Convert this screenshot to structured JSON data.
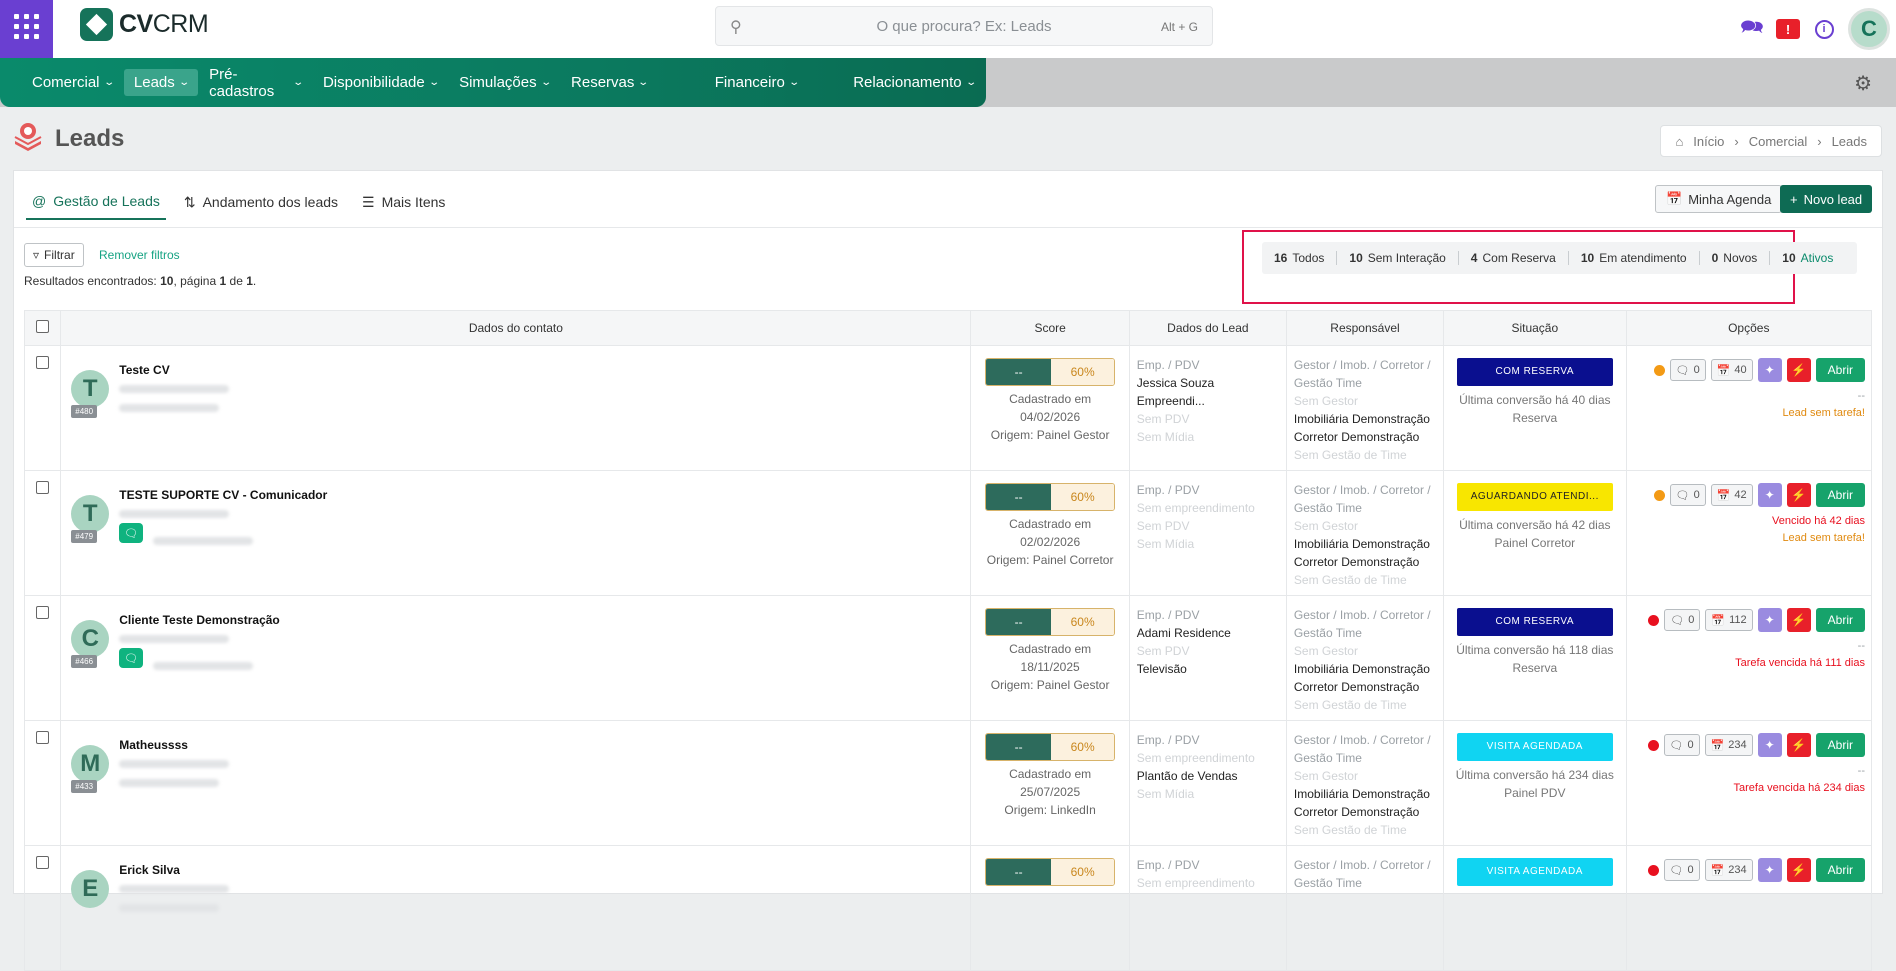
{
  "brand": {
    "name_bold": "CV",
    "name_rest": "CRM"
  },
  "search": {
    "placeholder": "O que procura? Ex: Leads",
    "shortcut": "Alt + G"
  },
  "user": {
    "initial": "C"
  },
  "nav": [
    {
      "label": "Comercial"
    },
    {
      "label": "Leads",
      "active": true
    },
    {
      "label": "Pré-cadastros"
    },
    {
      "label": "Disponibilidade"
    },
    {
      "label": "Simulações"
    },
    {
      "label": "Reservas"
    },
    {
      "label": "Financeiro"
    },
    {
      "label": "Relacionamento"
    }
  ],
  "page": {
    "title": "Leads"
  },
  "breadcrumb": [
    "Início",
    "Comercial",
    "Leads"
  ],
  "tabs": [
    "Gestão de Leads",
    "Andamento dos leads",
    "Mais Itens"
  ],
  "actions": {
    "agenda": "Minha Agenda",
    "new": "Novo lead"
  },
  "filters": {
    "filter_label": "Filtrar",
    "remove_label": "Remover filtros"
  },
  "results": {
    "prefix": "Resultados encontrados: ",
    "count": "10",
    "mid": ", página ",
    "page": "1",
    "of": " de ",
    "pages": "1",
    "end": "."
  },
  "stats": [
    {
      "n": "16",
      "label": "Todos"
    },
    {
      "n": "10",
      "label": "Sem Interação"
    },
    {
      "n": "4",
      "label": "Com Reserva"
    },
    {
      "n": "10",
      "label": "Em atendimento"
    },
    {
      "n": "0",
      "label": "Novos"
    },
    {
      "n": "10",
      "label": "Ativos"
    }
  ],
  "columns": [
    "Dados do contato",
    "Score",
    "Dados do Lead",
    "Responsável",
    "Situação",
    "Opções"
  ],
  "rows": [
    {
      "initial": "T",
      "name": "Teste CV",
      "id": "#480",
      "wa": false,
      "score_left": "--",
      "score_right": "60%",
      "cad": "Cadastrado em",
      "date": "04/02/2026",
      "origin": "Origem: Painel Gestor",
      "lead": [
        {
          "t": "Emp. / PDV",
          "c": "muted"
        },
        {
          "t": "Jessica Souza Empreendi...",
          "c": "dark"
        },
        {
          "t": "Sem PDV",
          "c": "faded"
        },
        {
          "t": "Sem Mídia",
          "c": "faded"
        }
      ],
      "resp": [
        {
          "t": "Gestor / Imob. / Corretor /",
          "c": "muted"
        },
        {
          "t": "Gestão Time",
          "c": "muted"
        },
        {
          "t": "Sem Gestor",
          "c": "faded"
        },
        {
          "t": "Imobiliária Demonstração",
          "c": "dark"
        },
        {
          "t": "Corretor Demonstração",
          "c": "dark"
        },
        {
          "t": "Sem Gestão de Time",
          "c": "faded"
        }
      ],
      "status": "COM RESERVA",
      "status_class": "b-navy",
      "sit1": "Última conversão há 40 dias",
      "sit2": "Reserva",
      "dot": "d-or",
      "chat": "0",
      "cal": "40",
      "abrir": "Abrir",
      "note1": "--",
      "note1c": "muted",
      "note2": "Lead sem tarefa!",
      "note2c": "o-or"
    },
    {
      "initial": "T",
      "name": "TESTE SUPORTE CV - Comunicador",
      "id": "#479",
      "wa": true,
      "score_left": "--",
      "score_right": "60%",
      "cad": "Cadastrado em",
      "date": "02/02/2026",
      "origin": "Origem: Painel Corretor",
      "lead": [
        {
          "t": "Emp. / PDV",
          "c": "muted"
        },
        {
          "t": "Sem empreendimento",
          "c": "faded"
        },
        {
          "t": "Sem PDV",
          "c": "faded"
        },
        {
          "t": "Sem Mídia",
          "c": "faded"
        }
      ],
      "resp": [
        {
          "t": "Gestor / Imob. / Corretor /",
          "c": "muted"
        },
        {
          "t": "Gestão Time",
          "c": "muted"
        },
        {
          "t": "Sem Gestor",
          "c": "faded"
        },
        {
          "t": "Imobiliária Demonstração",
          "c": "dark"
        },
        {
          "t": "Corretor Demonstração",
          "c": "dark"
        },
        {
          "t": "Sem Gestão de Time",
          "c": "faded"
        }
      ],
      "status": "AGUARDANDO ATENDI...",
      "status_class": "b-yellow",
      "sit1": "Última conversão há 42 dias",
      "sit2": "Painel Corretor",
      "dot": "d-or",
      "chat": "0",
      "cal": "42",
      "abrir": "Abrir",
      "note1": "Vencido há 42 dias",
      "note1c": "o-red",
      "note2": "Lead sem tarefa!",
      "note2c": "o-or"
    },
    {
      "initial": "C",
      "name": "Cliente Teste Demonstração",
      "id": "#466",
      "wa": true,
      "score_left": "--",
      "score_right": "60%",
      "cad": "Cadastrado em",
      "date": "18/11/2025",
      "origin": "Origem: Painel Gestor",
      "lead": [
        {
          "t": "Emp. / PDV",
          "c": "muted"
        },
        {
          "t": "Adami Residence",
          "c": "dark"
        },
        {
          "t": "Sem PDV",
          "c": "faded"
        },
        {
          "t": "Televisão",
          "c": "dark"
        }
      ],
      "resp": [
        {
          "t": "Gestor / Imob. / Corretor /",
          "c": "muted"
        },
        {
          "t": "Gestão Time",
          "c": "muted"
        },
        {
          "t": "Sem Gestor",
          "c": "faded"
        },
        {
          "t": "Imobiliária Demonstração",
          "c": "dark"
        },
        {
          "t": "Corretor Demonstração",
          "c": "dark"
        },
        {
          "t": "Sem Gestão de Time",
          "c": "faded"
        }
      ],
      "status": "COM RESERVA",
      "status_class": "b-navy",
      "sit1": "Última conversão há 118 dias",
      "sit2": "Reserva",
      "dot": "d-red",
      "chat": "0",
      "cal": "112",
      "abrir": "Abrir",
      "note1": "--",
      "note1c": "muted",
      "note2": "Tarefa vencida há 111 dias",
      "note2c": "o-red"
    },
    {
      "initial": "M",
      "name": "Matheussss",
      "id": "#433",
      "wa": false,
      "score_left": "--",
      "score_right": "60%",
      "cad": "Cadastrado em",
      "date": "25/07/2025",
      "origin": "Origem: LinkedIn",
      "lead": [
        {
          "t": "Emp. / PDV",
          "c": "muted"
        },
        {
          "t": "Sem empreendimento",
          "c": "faded"
        },
        {
          "t": "Plantão de Vendas",
          "c": "dark"
        },
        {
          "t": "Sem Mídia",
          "c": "faded"
        }
      ],
      "resp": [
        {
          "t": "Gestor / Imob. / Corretor /",
          "c": "muted"
        },
        {
          "t": "Gestão Time",
          "c": "muted"
        },
        {
          "t": "Sem Gestor",
          "c": "faded"
        },
        {
          "t": "Imobiliária Demonstração",
          "c": "dark"
        },
        {
          "t": "Corretor Demonstração",
          "c": "dark"
        },
        {
          "t": "Sem Gestão de Time",
          "c": "faded"
        }
      ],
      "status": "VISITA AGENDADA",
      "status_class": "b-cyan",
      "sit1": "Última conversão há 234 dias",
      "sit2": "Painel PDV",
      "dot": "d-red",
      "chat": "0",
      "cal": "234",
      "abrir": "Abrir",
      "note1": "--",
      "note1c": "muted",
      "note2": "Tarefa vencida há 234 dias",
      "note2c": "o-red"
    },
    {
      "initial": "E",
      "name": "Erick Silva",
      "id": "",
      "wa": false,
      "score_left": "--",
      "score_right": "60%",
      "cad": "",
      "date": "",
      "origin": "",
      "lead": [
        {
          "t": "Emp. / PDV",
          "c": "muted"
        },
        {
          "t": "Sem empreendimento",
          "c": "faded"
        }
      ],
      "resp": [
        {
          "t": "Gestor / Imob. / Corretor /",
          "c": "muted"
        },
        {
          "t": "Gestão Time",
          "c": "muted"
        }
      ],
      "status": "VISITA AGENDADA",
      "status_class": "b-cyan",
      "sit1": "",
      "sit2": "",
      "dot": "d-red",
      "chat": "0",
      "cal": "234",
      "abrir": "Abrir",
      "note1": "",
      "note1c": "muted",
      "note2": "",
      "note2c": "o-red"
    }
  ]
}
